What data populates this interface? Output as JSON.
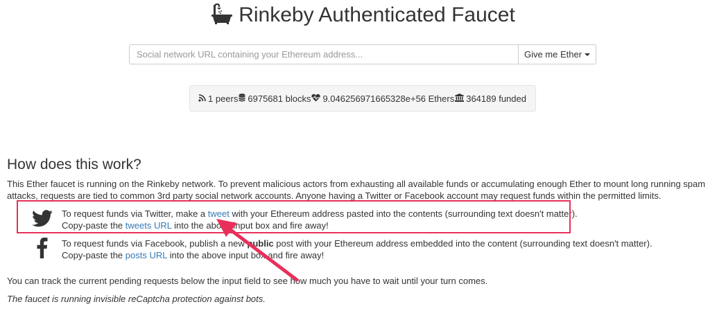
{
  "header": {
    "title": "Rinkeby Authenticated Faucet",
    "icon": "bathtub-icon"
  },
  "request_form": {
    "placeholder": "Social network URL containing your Ethereum address...",
    "value": "",
    "button_label": "Give me Ether"
  },
  "stats": {
    "peers": "1 peers",
    "blocks": "6975681 blocks",
    "ethers": "9.046256971665328e+56 Ethers",
    "funded": "364189 funded"
  },
  "how": {
    "heading": "How does this work?",
    "intro": "This Ether faucet is running on the Rinkeby network. To prevent malicious actors from exhausting all available funds or accumulating enough Ether to mount long running spam attacks, requests are tied to common 3rd party social network accounts. Anyone having a Twitter or Facebook account may request funds within the permitted limits.",
    "twitter": {
      "line1_before": "To request funds via Twitter, make a ",
      "line1_link": "tweet",
      "line1_after": " with your Ethereum address pasted into the contents (surrounding text doesn't matter).",
      "line2_before": "Copy-paste the ",
      "line2_link": "tweets URL",
      "line2_after": " into the above input box and fire away!"
    },
    "facebook": {
      "line1_before": "To request funds via Facebook, publish a new ",
      "line1_bold": "public",
      "line1_after": " post with your Ethereum address embedded into the content (surrounding text doesn't matter).",
      "line2_before": "Copy-paste the ",
      "line2_link": "posts URL",
      "line2_after": " into the above input box and fire away!"
    },
    "track_text": "You can track the current pending requests below the input field to see how much you have to wait until your turn comes.",
    "recaptcha_text": "The faucet is running invisible reCaptcha protection against bots."
  },
  "colors": {
    "link": "#337ab7",
    "annotation": "#e8305a"
  }
}
